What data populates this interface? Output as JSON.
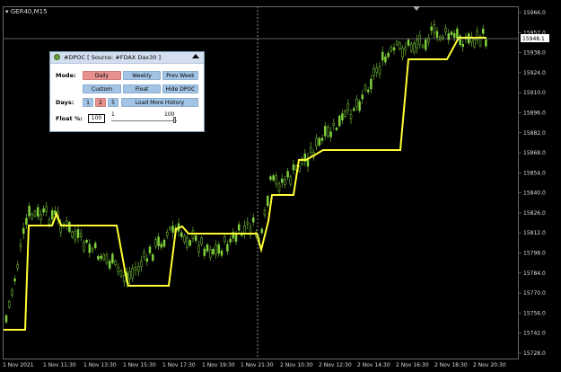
{
  "chart": {
    "symbol": "GER40,M15",
    "current_price": "15948.1",
    "price_axis": [
      "15966.0",
      "15957.0",
      "15938.0",
      "15924.0",
      "15910.0",
      "15896.0",
      "15882.0",
      "15868.0",
      "15854.0",
      "15840.0",
      "15826.0",
      "15812.0",
      "15798.0",
      "15784.0",
      "15770.0",
      "15756.0",
      "15742.0",
      "15728.0"
    ],
    "time_axis": [
      "1 Nov 2021",
      "1 Nov 11:30",
      "1 Nov 13:30",
      "1 Nov 15:30",
      "1 Nov 17:30",
      "1 Nov 19:30",
      "1 Nov 21:30",
      "2 Nov 10:30",
      "2 Nov 12:30",
      "2 Nov 14:30",
      "2 Nov 16:30",
      "2 Nov 18:30",
      "2 Nov 20:30"
    ],
    "colors": {
      "background": "#000000",
      "candle": "#7fd13b",
      "dpoc_line": "#ffff33",
      "grid": "#444444",
      "crosshair": "#cccccc"
    }
  },
  "panel": {
    "title": "#DPOC [ Source: #FDAX Dax30 ]",
    "logo_icon": "dpoc-logo-icon",
    "collapse_icon": "triangle-up-icon",
    "mode_label": "Mode:",
    "mode_buttons": [
      "Daily",
      "Weekly",
      "Prev Week",
      "Custom",
      "Float",
      "Hide DPOC"
    ],
    "days_label": "Days:",
    "days_buttons": [
      "1",
      "2",
      "5"
    ],
    "load_more_label": "Load More History",
    "float_label": "Float %:",
    "float_value": "100",
    "slider_min": "1",
    "slider_max": "100",
    "slider_level": 1.0
  }
}
